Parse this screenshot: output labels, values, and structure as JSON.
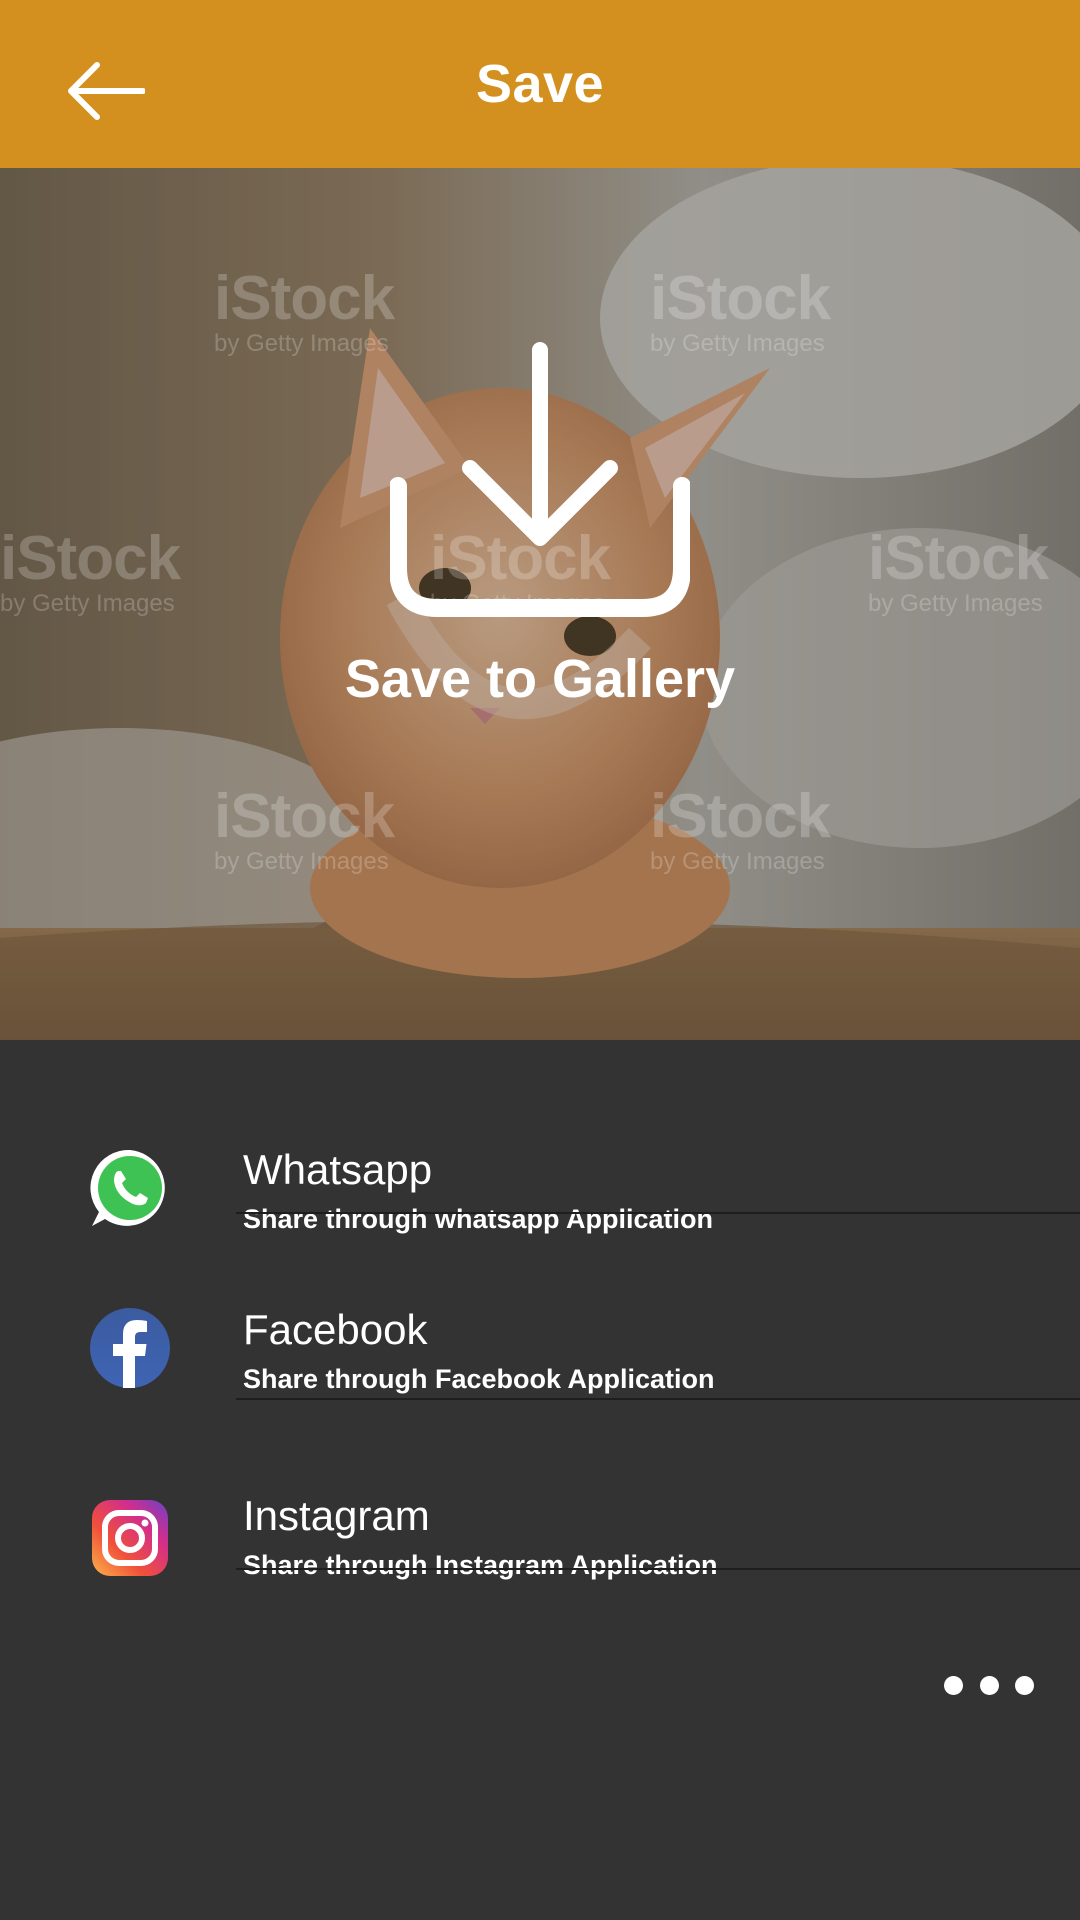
{
  "app_bar": {
    "title": "Save",
    "back_icon": "arrow-left-icon",
    "color": "#D4901E"
  },
  "hero": {
    "image": "kitten-photo",
    "watermark_main": "iStock",
    "watermark_sub": "by Getty Images",
    "save_icon": "download-icon",
    "save_label": "Save to Gallery"
  },
  "share_options": [
    {
      "icon": "whatsapp-icon",
      "name": "Whatsapp",
      "description": "Share through whatsapp Application"
    },
    {
      "icon": "facebook-icon",
      "name": "Facebook",
      "description": "Share through Facebook Application"
    },
    {
      "icon": "instagram-icon",
      "name": "Instagram",
      "description": "Share through Instagram Application"
    }
  ],
  "more_icon": "more-horizontal-icon"
}
